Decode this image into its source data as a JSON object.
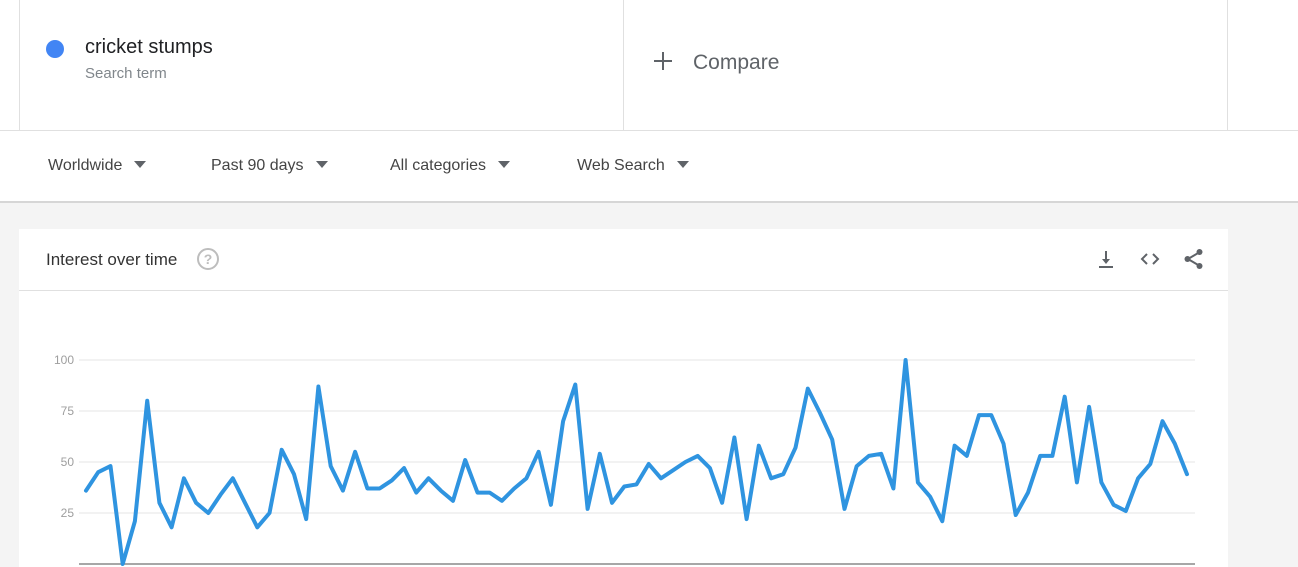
{
  "search_term": {
    "name": "cricket stumps",
    "subtitle": "Search term",
    "color": "#4285f4"
  },
  "compare": {
    "label": "Compare",
    "icon": "plus-icon"
  },
  "filters": {
    "region": "Worldwide",
    "time_range": "Past 90 days",
    "category": "All categories",
    "search_type": "Web Search"
  },
  "card": {
    "title": "Interest over time",
    "help_icon": "help-circle-icon",
    "help_glyph": "?",
    "actions": [
      "download-icon",
      "embed-code-icon",
      "share-icon"
    ]
  },
  "chart_data": {
    "type": "line",
    "title": "",
    "xlabel": "",
    "ylabel": "",
    "ylim": [
      0,
      100
    ],
    "yticks": [
      25,
      50,
      75,
      100
    ],
    "grid": true,
    "series": [
      {
        "color": "#2f94e0",
        "values": [
          36,
          45,
          48,
          0,
          21,
          80,
          30,
          18,
          42,
          30,
          25,
          34,
          42,
          30,
          18,
          25,
          56,
          44,
          22,
          87,
          48,
          36,
          55,
          37,
          37,
          41,
          47,
          35,
          42,
          36,
          31,
          51,
          35,
          35,
          31,
          37,
          42,
          55,
          29,
          70,
          88,
          27,
          54,
          30,
          38,
          39,
          49,
          42,
          46,
          50,
          53,
          47,
          30,
          62,
          22,
          58,
          42,
          44,
          57,
          86,
          74,
          61,
          27,
          48,
          53,
          54,
          37,
          100,
          40,
          33,
          21,
          58,
          53,
          73,
          73,
          59,
          24,
          35,
          53,
          53,
          82,
          40,
          77,
          40,
          29,
          26,
          42,
          49,
          70,
          59,
          44
        ]
      }
    ]
  }
}
